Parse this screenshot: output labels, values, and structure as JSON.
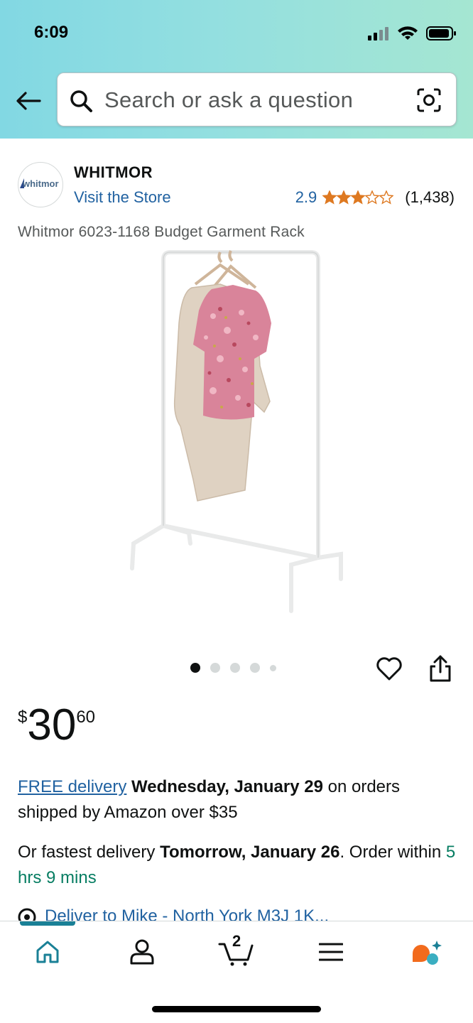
{
  "status_bar": {
    "time": "6:09"
  },
  "search": {
    "placeholder": "Search or ask a question"
  },
  "brand": {
    "logo_text": "whitmor",
    "name": "WHITMOR",
    "visit_store": "Visit the Store"
  },
  "rating": {
    "value": "2.9",
    "stars": 2.9,
    "count": "(1,438)"
  },
  "product": {
    "title": "Whitmor 6023-1168 Budget Garment Rack"
  },
  "carousel": {
    "total": 5,
    "active_index": 0
  },
  "price": {
    "symbol": "$",
    "whole": "30",
    "fraction": "60"
  },
  "delivery": {
    "free_label": "FREE delivery",
    "date": "Wednesday, January 29",
    "suffix": " on orders shipped by Amazon over $35"
  },
  "fastest": {
    "prefix": "Or fastest delivery ",
    "date": "Tomorrow, January 26",
    "middle": ". Order within ",
    "countdown": "5 hrs 9 mins"
  },
  "deliver_to": {
    "label": "Deliver to Mike - North York M3J 1K..."
  },
  "cart": {
    "count": "2"
  },
  "colors": {
    "link": "#2162a1",
    "star": "#de7921",
    "green": "#067d62",
    "nav_accent": "#1a8096",
    "header_start": "#82d8e3",
    "header_end": "#a5e6d2"
  }
}
